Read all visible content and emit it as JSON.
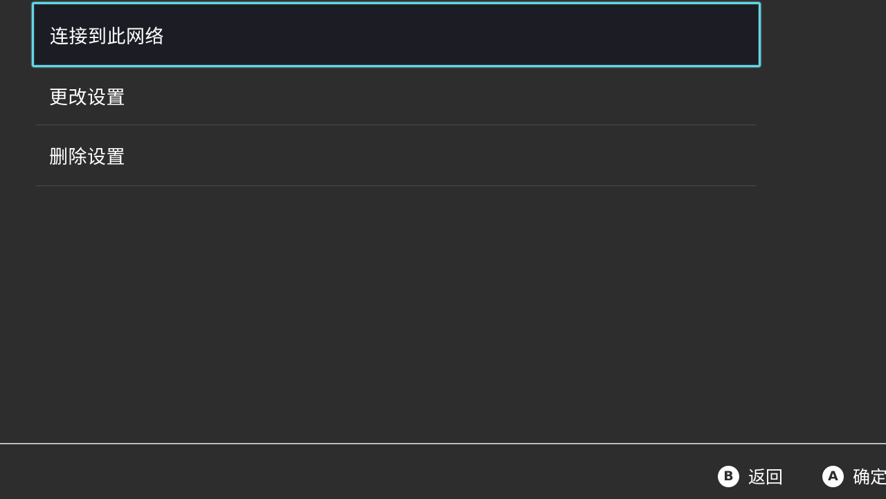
{
  "menu": {
    "items": [
      {
        "label": "连接到此网络",
        "selected": true
      },
      {
        "label": "更改设置",
        "selected": false
      },
      {
        "label": "删除设置",
        "selected": false
      }
    ]
  },
  "footer": {
    "back": {
      "button": "B",
      "label": "返回"
    },
    "confirm": {
      "button": "A",
      "label": "确定"
    }
  },
  "colors": {
    "background": "#2d2d2d",
    "selection_border": "#5ed8e8",
    "selected_bg": "#1c1c24",
    "text": "#ffffff"
  }
}
